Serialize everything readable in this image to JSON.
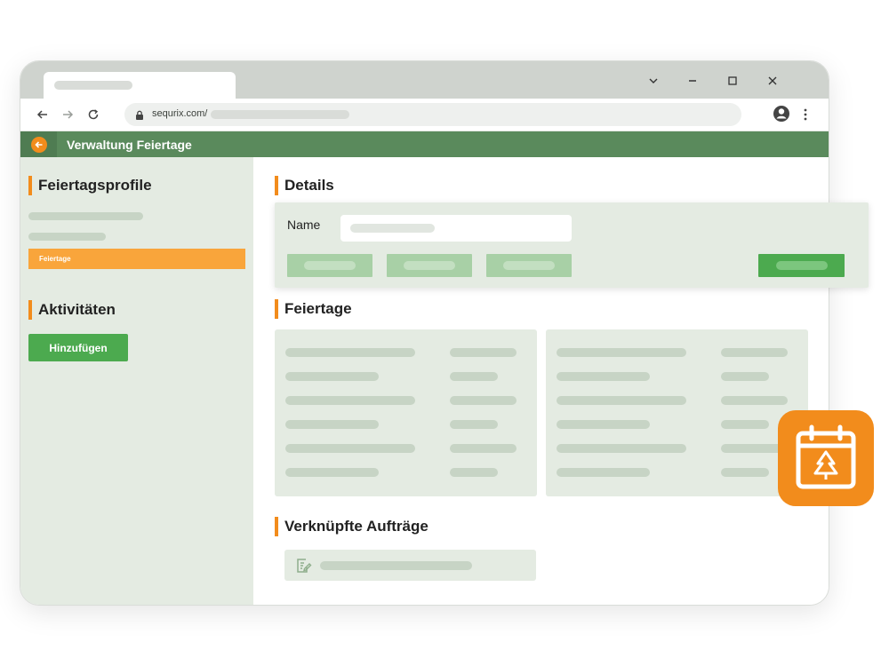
{
  "browser": {
    "url_text": "sequrix.com/"
  },
  "app": {
    "title": "Verwaltung Feiertage"
  },
  "sidebar": {
    "profiles_title": "Feiertagsprofile",
    "active_item_label": "Feiertage",
    "activities_title": "Aktivitäten",
    "add_button_label": "Hinzufügen"
  },
  "main": {
    "details_title": "Details",
    "name_label": "Name",
    "holidays_title": "Feiertage",
    "linked_orders_title": "Verknüpfte Aufträge"
  },
  "colors": {
    "accent": "#f28c1c",
    "app_bar": "#5a8a5c",
    "primary_button": "#4caa4f",
    "panel": "#e4ebe2"
  },
  "icons": {
    "badge": "calendar-tree-icon",
    "linked_order": "document-edit-icon"
  }
}
